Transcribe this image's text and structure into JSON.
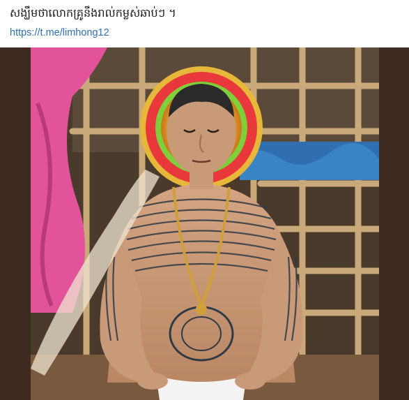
{
  "post": {
    "caption": "សង្ឃឹមថាលោកគ្រូនឹងរាល់កម្លស់ឆាប់ៗ ។",
    "link_text": "https://t.me/limhong12"
  },
  "media": {
    "kind": "video-frame",
    "colors": {
      "frame_bg": "#3e2a20",
      "wall": "#4a3a2c",
      "bamboo": "#c9a87a",
      "skin": "#c99a78",
      "tattoo_ink": "#2f3a44",
      "halo_red": "#e8383c",
      "halo_green": "#7ecf3a",
      "halo_gold": "#e7b73a",
      "pink_cloth": "#e2539b",
      "blue_cloth": "#2f6fb0",
      "gold_chain": "#cfa03a",
      "white_cloth": "#f3f3f3"
    }
  }
}
